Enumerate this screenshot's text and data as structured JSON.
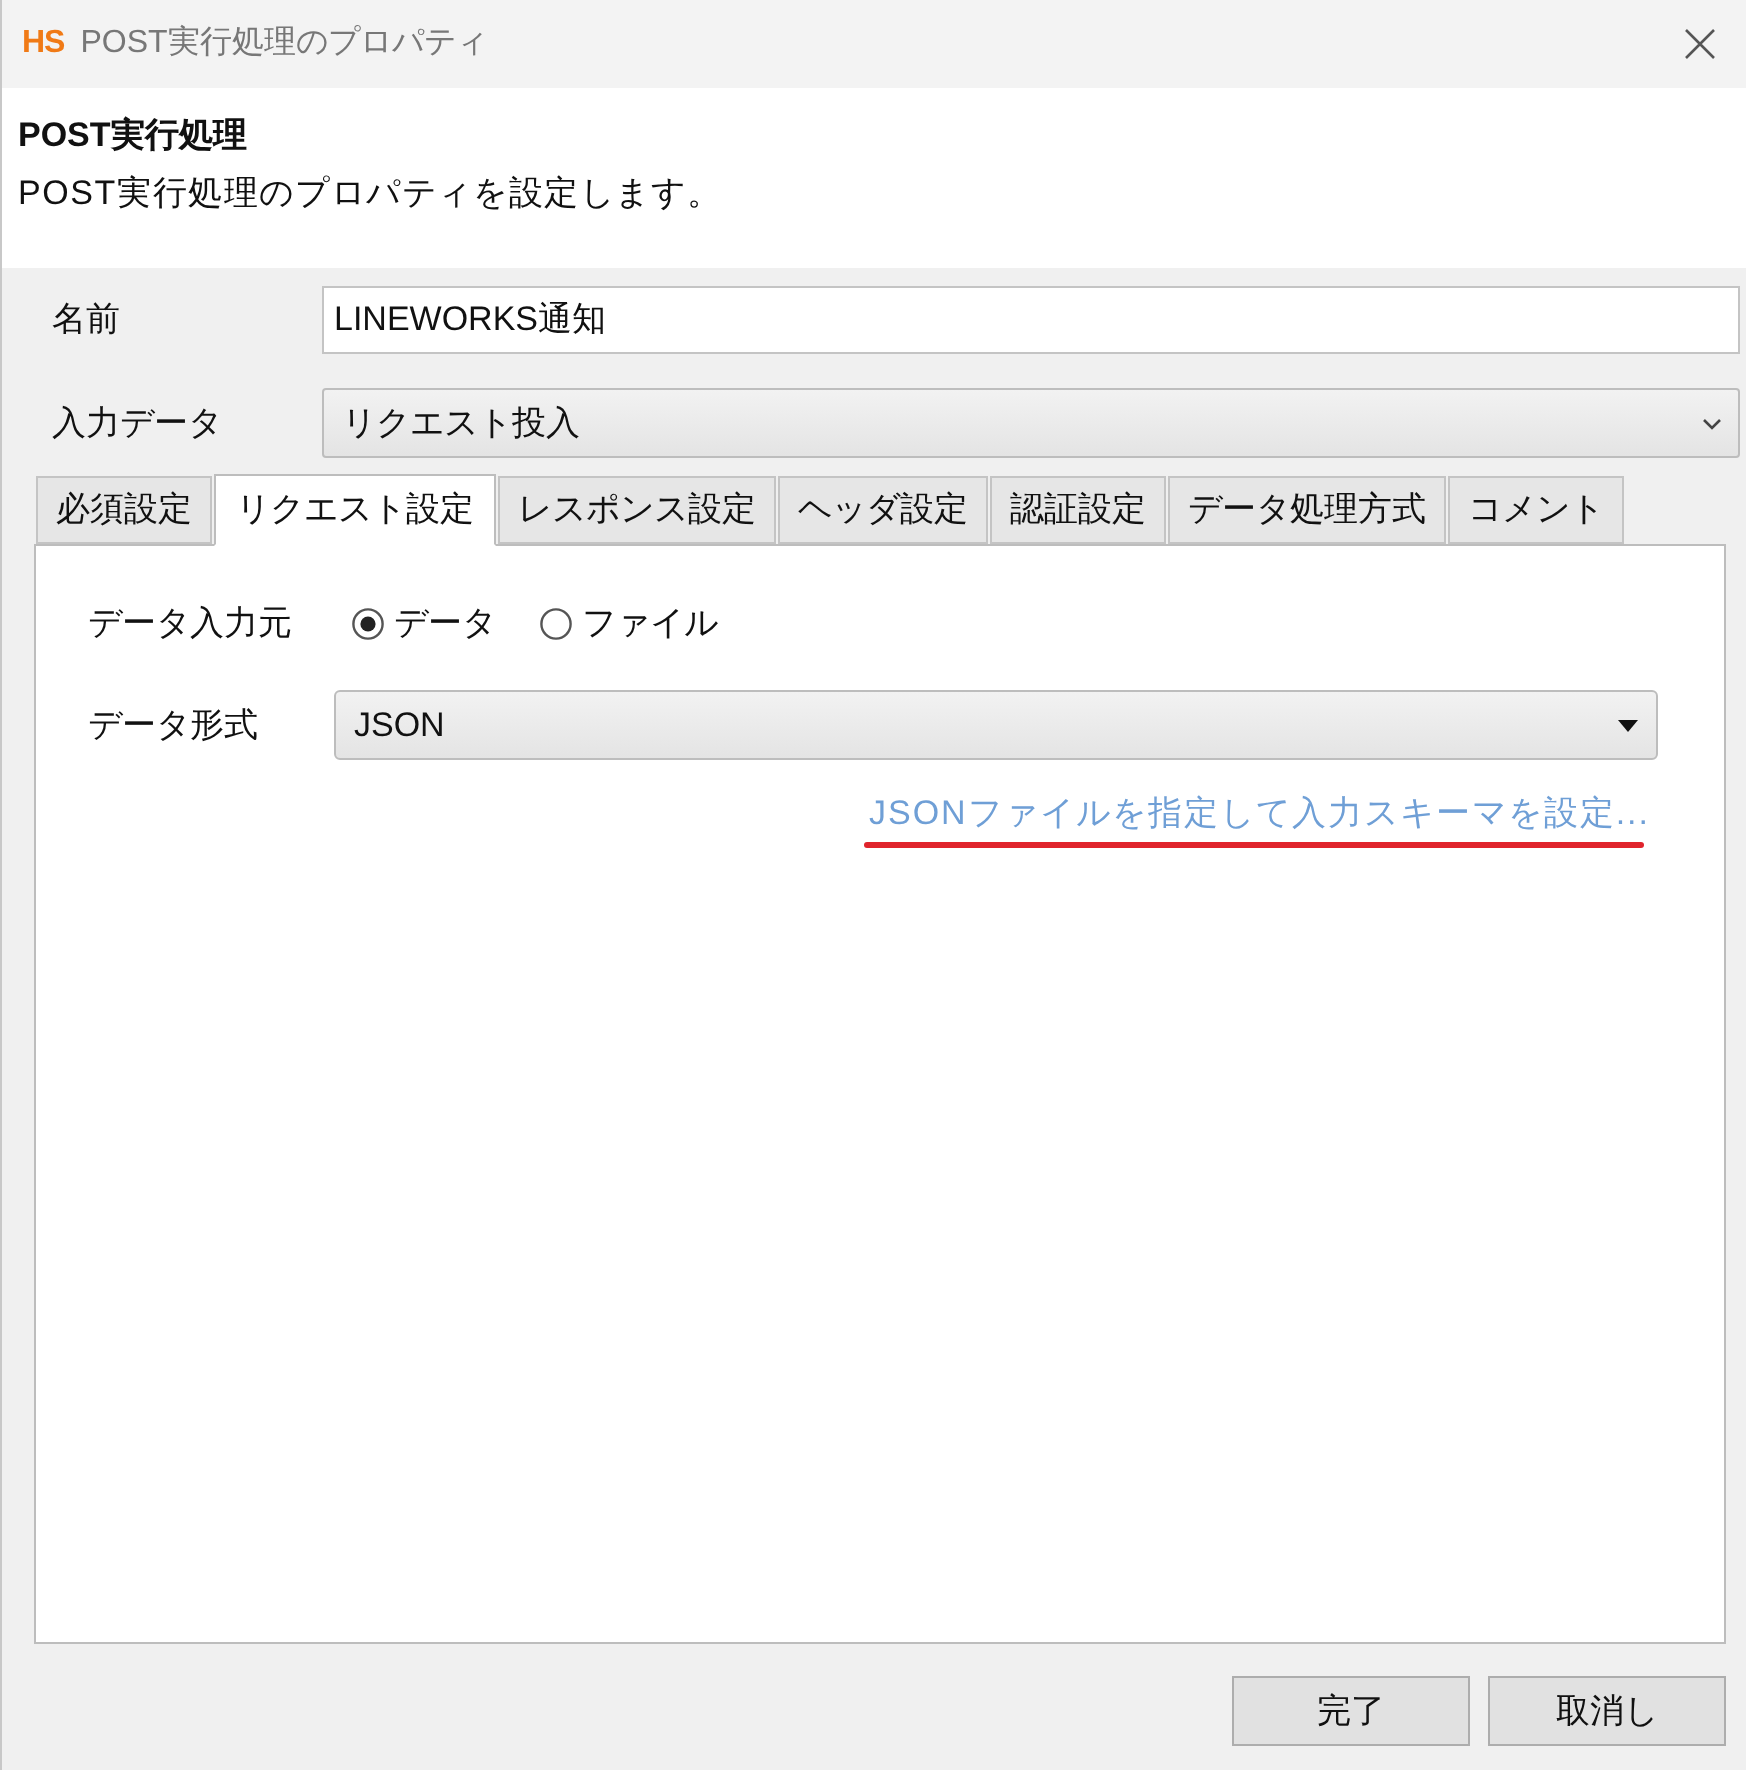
{
  "window": {
    "logo": "HS",
    "title": "POST実行処理のプロパティ"
  },
  "header": {
    "title": "POST実行処理",
    "description": "POST実行処理のプロパティを設定します。"
  },
  "fields": [
    {
      "kind": "text",
      "label": "名前",
      "value": "LINEWORKS通知"
    },
    {
      "kind": "select",
      "label": "入力データ",
      "value": "リクエスト投入"
    }
  ],
  "tabs": [
    {
      "label": "必須設定",
      "selected": false
    },
    {
      "label": "リクエスト設定",
      "selected": true
    },
    {
      "label": "レスポンス設定",
      "selected": false
    },
    {
      "label": "ヘッダ設定",
      "selected": false
    },
    {
      "label": "認証設定",
      "selected": false
    },
    {
      "label": "データ処理方式",
      "selected": false
    },
    {
      "label": "コメント",
      "selected": false
    }
  ],
  "panel": {
    "source": {
      "label": "データ入力元",
      "options": [
        {
          "label": "データ",
          "selected": true
        },
        {
          "label": "ファイル",
          "selected": false
        }
      ]
    },
    "format": {
      "label": "データ形式",
      "value": "JSON"
    },
    "link": "JSONファイルを指定して入力スキーマを設定..."
  },
  "buttons": [
    "完了",
    "取消し"
  ]
}
